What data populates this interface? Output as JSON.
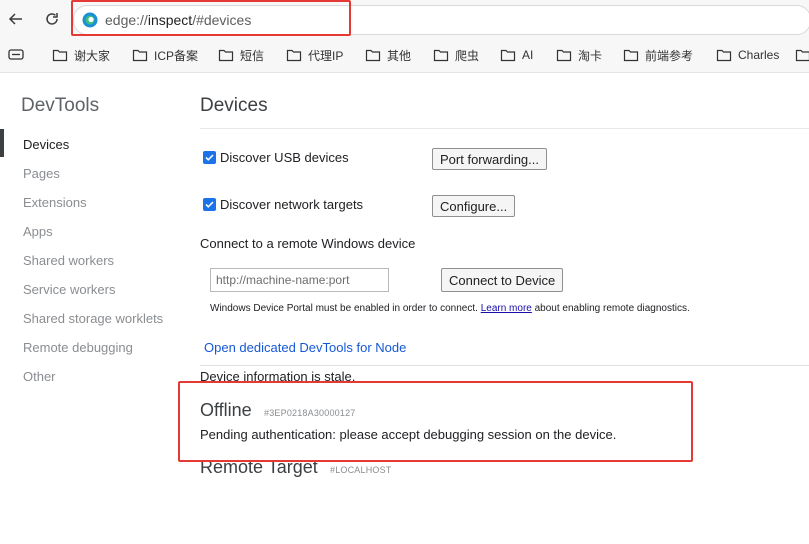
{
  "browser": {
    "url_scheme": "edge://",
    "url_host": "inspect",
    "url_path": "/#devices",
    "bookmarks": [
      "谢大家",
      "ICP备案",
      "短信",
      "代理IP",
      "其他",
      "爬虫",
      "AI",
      "淘卡",
      "前端参考",
      "Charles"
    ]
  },
  "sidebar": {
    "title": "DevTools",
    "items": [
      "Devices",
      "Pages",
      "Extensions",
      "Apps",
      "Shared workers",
      "Service workers",
      "Shared storage worklets",
      "Remote debugging",
      "Other"
    ]
  },
  "main": {
    "title": "Devices",
    "discover_usb": {
      "label": "Discover USB devices",
      "checked": true
    },
    "port_forwarding_label": "Port forwarding...",
    "discover_network": {
      "label": "Discover network targets",
      "checked": true
    },
    "configure_label": "Configure...",
    "remote_windows_label": "Connect to a remote Windows device",
    "machine_name_placeholder": "http://machine-name:port",
    "connect_label": "Connect to Device",
    "portal_note_before": "Windows Device Portal must be enabled in order to connect. ",
    "learn_more": "Learn more",
    "portal_note_after": " about enabling remote diagnostics.",
    "open_node_link": "Open dedicated DevTools for Node",
    "stale_notice": "Device information is stale.",
    "devices": [
      {
        "name": "Offline",
        "serial": "#3EP0218A30000127",
        "status": "Pending authentication: please accept debugging session on the device."
      },
      {
        "name": "Remote Target",
        "serial": "#LOCALHOST"
      }
    ]
  },
  "colors": {
    "checkbox_accent": "#1a73e8",
    "link": "#1558d6",
    "annotation_red": "#e53935"
  }
}
